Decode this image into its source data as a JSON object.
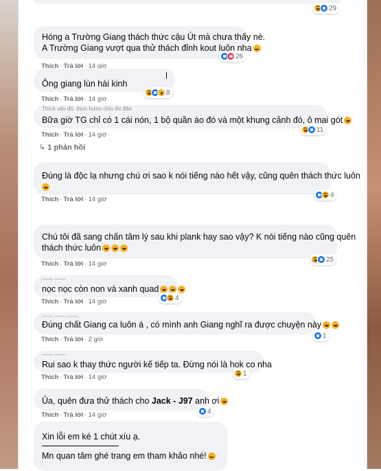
{
  "labels": {
    "like": "Thích",
    "reply": "Trả lời",
    "sep": "·"
  },
  "comments": [
    {
      "lines": [
        "Hóng a Trường Giang thách thức cậu Út mà chưa thấy nè.",
        "A Trường Giang vượt qua thử thách đỉnh kout luôn nha"
      ],
      "time": "14 giờ",
      "reactions": {
        "icons": [
          "like",
          "love"
        ],
        "count": "26"
      }
    },
    {
      "lines": [
        "Ông giang lùn hài kinh"
      ],
      "time": "14 giờ",
      "reactions": {
        "icons": [
          "haha",
          "like",
          "wow"
        ],
        "count": "8"
      }
    },
    {
      "ghost": "Thích vậy đó, thực hứng chịu thì đấn",
      "lines": [
        "Bữa giờ TG chỉ có 1 cái nón, 1 bộ quần áo đó và một khung cảnh đó, ô mai gót"
      ],
      "time": "14 giờ",
      "reactions": {
        "icons": [
          "haha",
          "like"
        ],
        "count": "11"
      },
      "replies": "1 phản hồi"
    },
    {
      "lines": [
        "Đúng là độc lạ nhưng chú ơi sao k nói tiếng nào hết vậy, cũng quên thách thức luôn"
      ],
      "time": "14 giờ",
      "reactions": {
        "icons": [
          "like",
          "haha"
        ],
        "count": "4"
      }
    },
    {
      "lines": [
        "Chú tôi đã sang chấn tâm lý sau khi plank hay sao vậy? K nói tiếng nào cũng quên",
        "thách thức luôn"
      ],
      "time": "14 giờ",
      "reactions": {
        "icons": [
          "haha",
          "like"
        ],
        "count": "25"
      }
    },
    {
      "lines": [
        "nọc nọc còn non và xanh quad"
      ],
      "time": "14 giờ",
      "reactions": {
        "icons": [
          "like",
          "haha"
        ],
        "count": "4"
      }
    },
    {
      "lines": [
        "Đúng chất Giang ca luôn á , có mình anh Giang nghĩ ra được chuyện này"
      ],
      "time": "2 giờ",
      "reactions": {
        "icons": [
          "like"
        ],
        "count": "1"
      }
    },
    {
      "lines": [
        "Rui sao k thay thức người kế tiếp ta. Đừng nói là hok co nha"
      ],
      "time": "14 giờ",
      "reactions": {
        "icons": [
          "haha"
        ],
        "count": "1"
      }
    },
    {
      "lines": [
        "Ủa, quên đưa thử thách cho"
      ],
      "mention": "Jack - J97",
      "tail": " anh ơi",
      "time": "14 giờ",
      "reactions": {
        "icons": [
          "like"
        ],
        "count": "4"
      }
    },
    {
      "lines": [
        "Xin lỗi em ké 1 chút xíu ạ.",
        "Mn quan tâm ghé trang em tham khảo nhé!"
      ]
    }
  ],
  "top_reaction": {
    "icons": [
      "haha",
      "like"
    ],
    "count": "29"
  }
}
